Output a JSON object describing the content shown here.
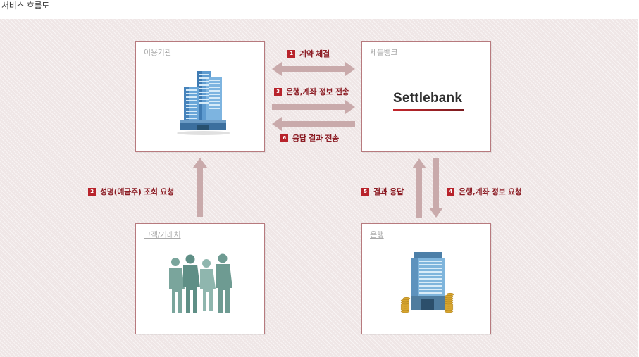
{
  "page": {
    "title": "서비스 흐름도"
  },
  "nodes": {
    "client": {
      "label": "이용기관",
      "icon": "office-building-icon"
    },
    "settlebank": {
      "label": "세틀뱅크",
      "logo_text": "Settlebank"
    },
    "customer": {
      "label": "고객/거래처",
      "icon": "people-silhouette-icon"
    },
    "bank": {
      "label": "은행",
      "icon": "bank-building-coins-icon"
    }
  },
  "steps": [
    {
      "num": "1",
      "text": "계약 체결"
    },
    {
      "num": "2",
      "text": "성명(예금주) 조회 요청"
    },
    {
      "num": "3",
      "text": "은행,계좌 정보 전송"
    },
    {
      "num": "4",
      "text": "은행,계좌 정보 요청"
    },
    {
      "num": "5",
      "text": "결과 응답"
    },
    {
      "num": "6",
      "text": "응답 결과 전송"
    }
  ],
  "colors": {
    "badge": "#b8232b",
    "step_text": "#8c1c24",
    "arrow": "#c9aaab",
    "box_border": "#b77a7e",
    "logo_red": "#c4262c"
  }
}
